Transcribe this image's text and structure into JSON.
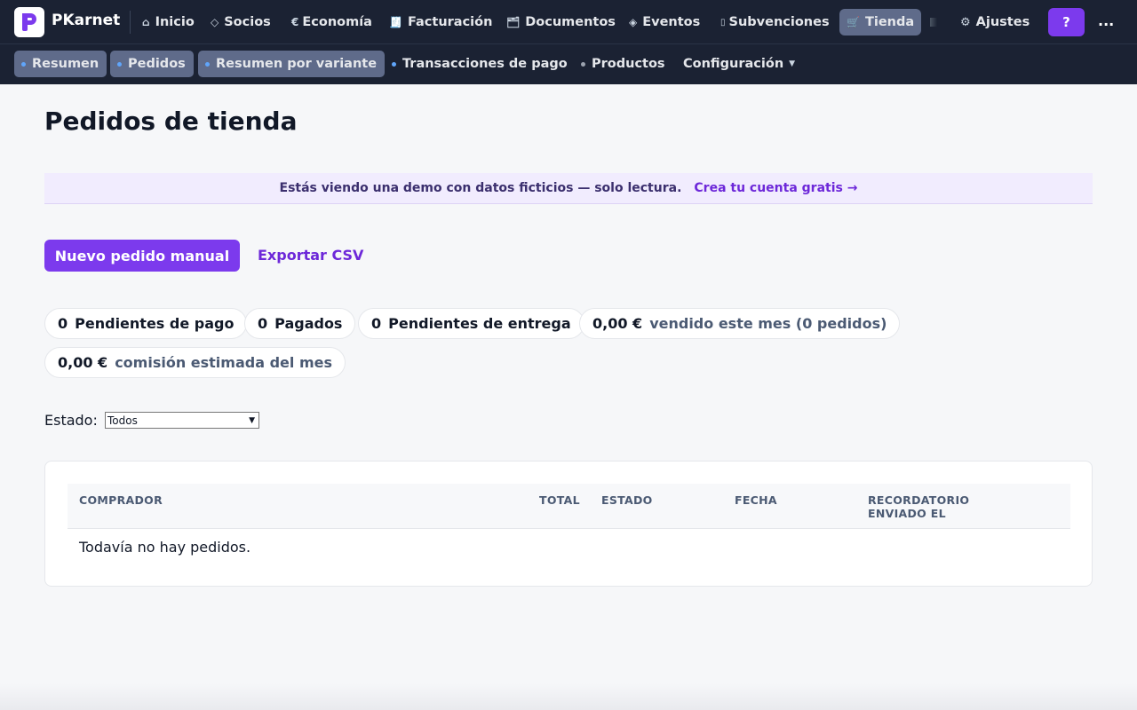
{
  "app": {
    "brand": "PKarnet"
  },
  "topnav": {
    "items": [
      {
        "label": "Inicio",
        "icon": "⌂"
      },
      {
        "label": "Socios",
        "icon": "◇"
      },
      {
        "label": "Economía",
        "icon": "€"
      },
      {
        "label": "Facturación",
        "icon": "🧾"
      },
      {
        "label": "Documentos",
        "icon": "🗂"
      },
      {
        "label": "Eventos",
        "icon": "◈"
      },
      {
        "label": "Subvenciones",
        "icon": "▯"
      },
      {
        "label": "Tienda",
        "icon": "🛒"
      },
      {
        "label": "Ajustes",
        "icon": "⚙"
      }
    ],
    "help_label": "?",
    "more_label": "..."
  },
  "subnav": {
    "items": [
      {
        "label": "Resumen"
      },
      {
        "label": "Pedidos"
      },
      {
        "label": "Resumen por variante"
      },
      {
        "label": "Transacciones de pago"
      },
      {
        "label": "Productos"
      },
      {
        "label": "Configuración"
      }
    ]
  },
  "page": {
    "title": "Pedidos de tienda",
    "demo_text": "Estás viendo una demo con datos ficticios — solo lectura.",
    "demo_link": "Crea tu cuenta gratis →",
    "new_order_button": "Nuevo pedido manual",
    "export_link": "Exportar CSV"
  },
  "stats": [
    {
      "value": "0",
      "label": "Pendientes de pago"
    },
    {
      "value": "0",
      "label": "Pagados"
    },
    {
      "value": "0",
      "label": "Pendientes de entrega"
    },
    {
      "value": "0,00 €",
      "label": "vendido este mes (0 pedidos)"
    },
    {
      "value": "0,00 €",
      "label": "comisión estimada del mes"
    }
  ],
  "filter": {
    "label": "Estado:",
    "selected": "Todos"
  },
  "table": {
    "headers": [
      "COMPRADOR",
      "TOTAL",
      "ESTADO",
      "FECHA",
      "RECORDATORIO",
      "ENVIADO EL"
    ],
    "empty_message": "Todavía no hay pedidos."
  },
  "colors": {
    "accent": "#7c3aed",
    "nav_bg": "#1b2233",
    "active_nav": "#5f6b8a"
  }
}
